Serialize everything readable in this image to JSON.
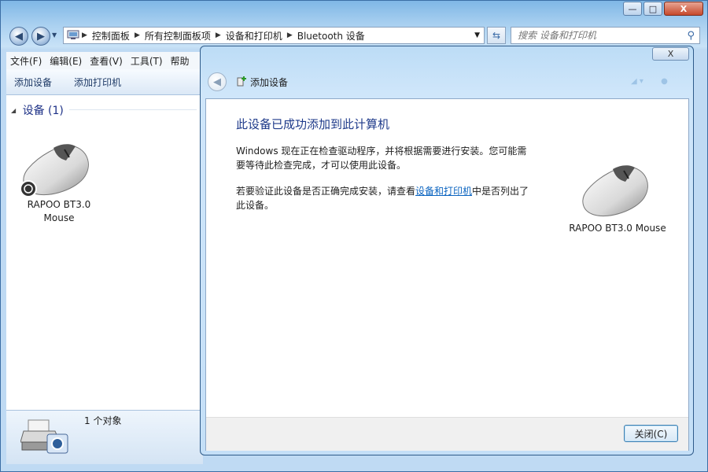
{
  "window": {
    "minimize_glyph": "—",
    "maximize_glyph": "□",
    "close_glyph": "X"
  },
  "address": {
    "crumbs": [
      "控制面板",
      "所有控制面板项",
      "设备和打印机",
      "Bluetooth 设备"
    ]
  },
  "search": {
    "placeholder": "搜索 设备和打印机"
  },
  "menu": {
    "items": [
      "文件(F)",
      "编辑(E)",
      "查看(V)",
      "工具(T)",
      "帮助"
    ]
  },
  "toolbar": {
    "add_device": "添加设备",
    "add_printer": "添加打印机"
  },
  "devices_group": {
    "header": "设备 (1)"
  },
  "left_device": {
    "label_line1": "RAPOO BT3.0",
    "label_line2": "Mouse"
  },
  "details": {
    "count": "1 个对象"
  },
  "dialog": {
    "title": "添加设备",
    "close_glyph": "X",
    "heading": "此设备已成功添加到此计算机",
    "para1": "Windows 现在正在检查驱动程序，并将根据需要进行安装。您可能需要等待此检查完成，才可以使用此设备。",
    "para2_before": "若要验证此设备是否正确完成安装，请查看",
    "para2_link": "设备和打印机",
    "para2_after": "中是否列出了此设备。",
    "device_name": "RAPOO BT3.0 Mouse",
    "close_button": "关闭(C)"
  },
  "colors": {
    "heading": "#1e3a8a",
    "link": "#0b64c0",
    "group_header": "#1e3287"
  }
}
